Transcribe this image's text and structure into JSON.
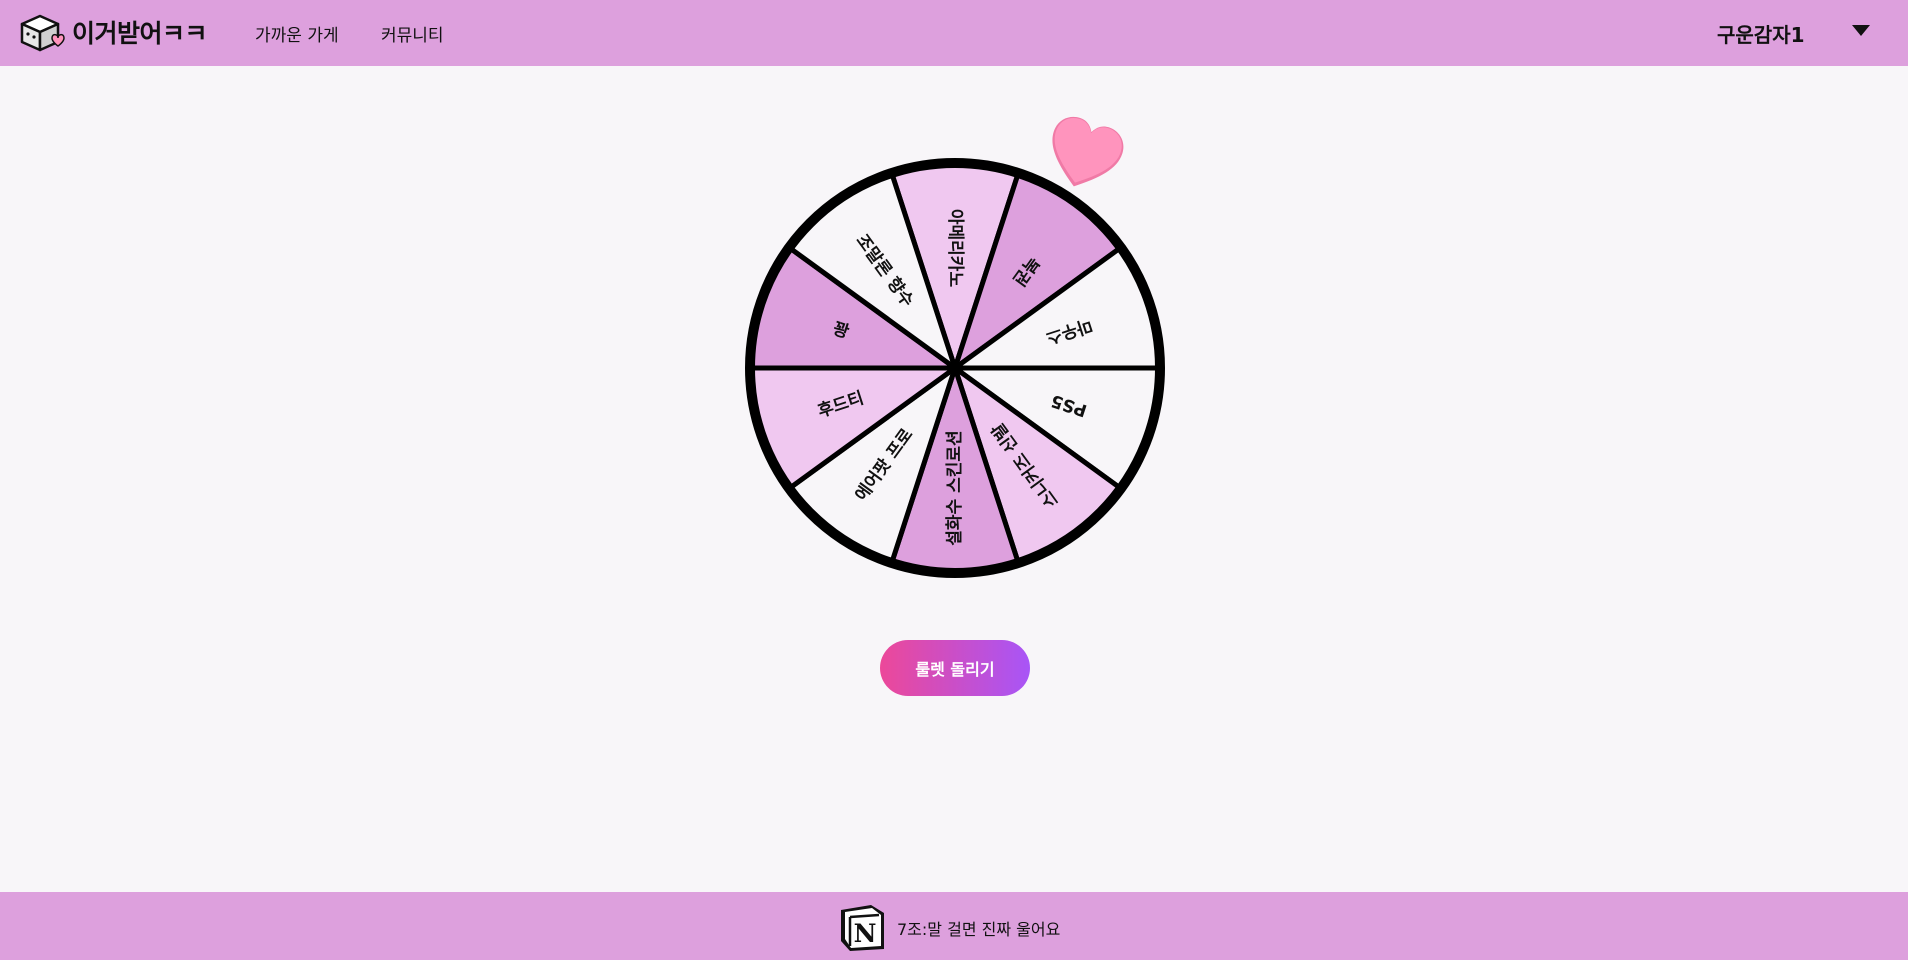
{
  "header": {
    "brand": "이거받어ㅋㅋ",
    "nav": [
      "가까운 가게",
      "커뮤니티"
    ],
    "user_name": "구운감자1"
  },
  "wheel": {
    "segments": [
      {
        "label": "아메리카노",
        "color": "#f0c8f0"
      },
      {
        "label": "복권",
        "color": "#dda0dd"
      },
      {
        "label": "마우스",
        "color": "#f8f6f9"
      },
      {
        "label": "PS5",
        "color": "#f8f6f9"
      },
      {
        "label": "스니커즈 신발",
        "color": "#f0c8f0"
      },
      {
        "label": "설화수 스킨로션",
        "color": "#dda0dd"
      },
      {
        "label": "에어팟 프로",
        "color": "#f8f6f9"
      },
      {
        "label": "후드티",
        "color": "#f0c8f0"
      },
      {
        "label": "꽝",
        "color": "#dda0dd"
      },
      {
        "label": "조말론 향수",
        "color": "#f8f6f9"
      }
    ]
  },
  "spin_button": "룰렛 돌리기",
  "footer": {
    "text": "7조:말 걸면 진짜 울어요"
  },
  "colors": {
    "header_bg": "#dda0dd",
    "footer_bg": "#dda0dd",
    "page_bg": "#f8f6f9",
    "button_gradient_start": "#ec4899",
    "button_gradient_end": "#a855f7",
    "heart": "#ff94bd"
  }
}
